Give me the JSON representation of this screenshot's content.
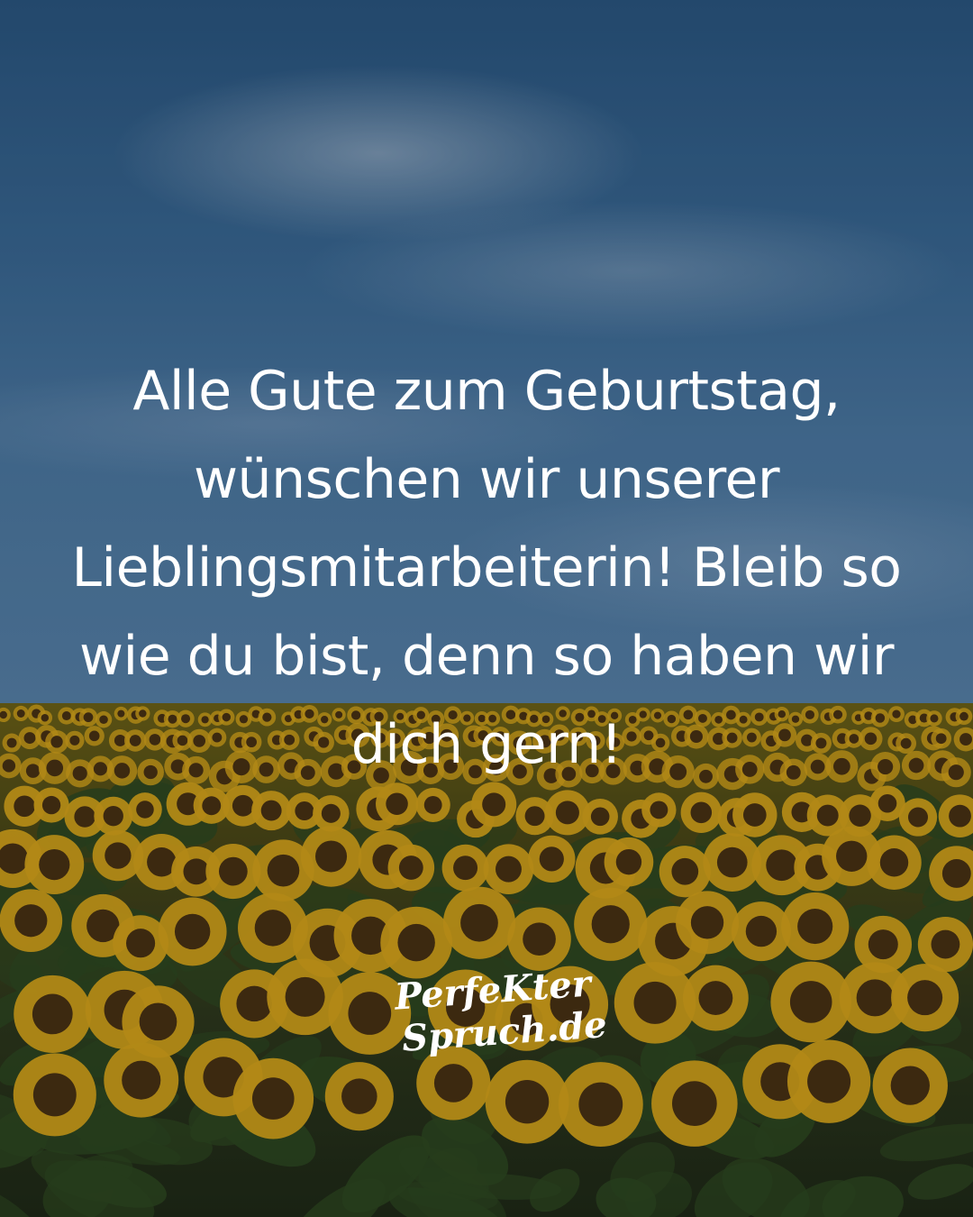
{
  "quote": {
    "lines": [
      "Alle Gute zum Geburtstag,",
      "wünschen wir unserer",
      "Lieblingsmitarbeiterin! Bleib so",
      "wie du bist, denn so haben wir",
      "dich gern!"
    ]
  },
  "logo": {
    "line1": "PerfeKter",
    "line2": "Spruch.de"
  },
  "colors": {
    "text": "#ffffff",
    "sky": "#3b6b98",
    "petal": "#d9a81c",
    "center": "#4a3214",
    "leaf": "#2f4a22"
  }
}
